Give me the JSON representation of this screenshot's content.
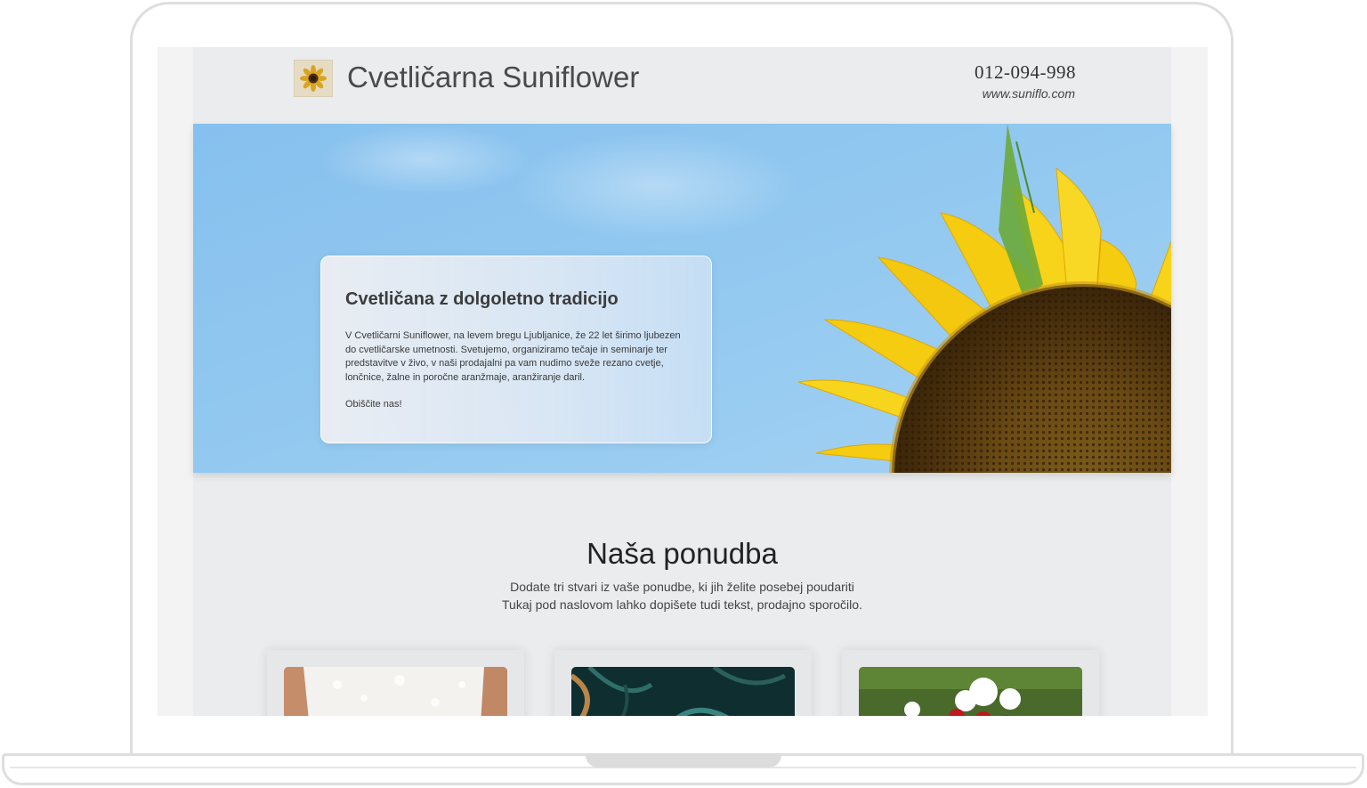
{
  "header": {
    "brand": "Cvetličarna Suniflower",
    "phone": "012-094-998",
    "website": "www.suniflo.com"
  },
  "hero": {
    "title": "Cvetličana z dolgoletno tradicijo",
    "text": "V Cvetličarni Suniflower, na levem bregu Ljubljanice, že 22 let širimo ljubezen do cvetličarske umetnosti. Svetujemo, organiziramo tečaje in seminarje ter predstavitve v živo, v naši prodajalni pa vam nudimo sveže rezano cvetje, lončnice, žalne in poročne aranžmaje, aranžiranje daril.",
    "cta": "Obiščite nas!"
  },
  "offer": {
    "title": "Naša ponudba",
    "subtitle_line1": "Dodate tri stvari iz vaše ponudbe, ki jih želite posebej poudariti",
    "subtitle_line2": "Tukaj pod naslovom lahko dopišete tudi tekst, prodajno sporočilo."
  },
  "icons": {
    "logo": "sunflower-logo-icon"
  },
  "colors": {
    "page_bg": "#ebecee",
    "sky": "#8fc6ef",
    "petal": "#f6cf12",
    "text_dark": "#222222"
  }
}
